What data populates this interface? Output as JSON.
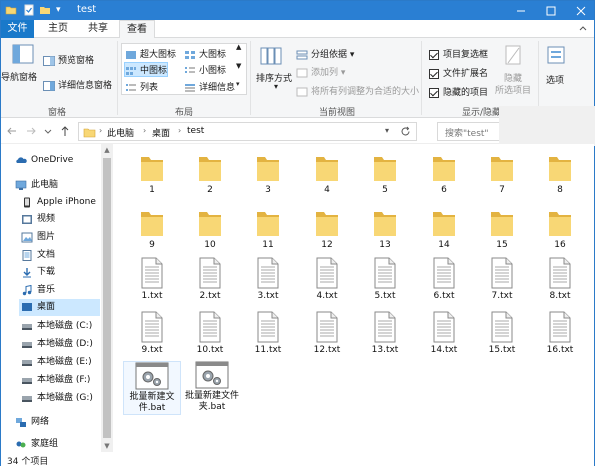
{
  "window": {
    "title": "test"
  },
  "ribbon": {
    "tabs": [
      {
        "label": "文件"
      },
      {
        "label": "主页"
      },
      {
        "label": "共享"
      },
      {
        "label": "查看"
      }
    ],
    "pane_group": {
      "nav_pane": "导航窗格",
      "preview": "预览窗格",
      "details": "详细信息窗格",
      "group_label": "窗格"
    },
    "layout_group": {
      "items": [
        "超大图标",
        "大图标",
        "中图标",
        "小图标",
        "列表",
        "详细信息"
      ],
      "group_label": "布局"
    },
    "view_group": {
      "sort_by": "排序方式",
      "group_by": "分组依据",
      "add_column": "添加列",
      "fit_columns": "将所有列调整为合适的大小",
      "group_label": "当前视图"
    },
    "show_group": {
      "checkboxes": [
        "项目复选框",
        "文件扩展名",
        "隐藏的项目"
      ],
      "hide": "隐藏",
      "hide_selected": "所选项目",
      "options": "选项",
      "group_label": "显示/隐藏"
    }
  },
  "address": {
    "crumbs": [
      "此电脑",
      "桌面",
      "test"
    ],
    "search_placeholder": "搜索\"test\""
  },
  "nav_pane": {
    "items": [
      {
        "label": "OneDrive",
        "icon": "onedrive-icon"
      },
      {
        "label": "此电脑",
        "icon": "computer-icon"
      },
      {
        "label": "Apple iPhone",
        "icon": "phone-icon"
      },
      {
        "label": "视频",
        "icon": "video-icon"
      },
      {
        "label": "图片",
        "icon": "pictures-icon"
      },
      {
        "label": "文档",
        "icon": "documents-icon"
      },
      {
        "label": "下载",
        "icon": "download-icon"
      },
      {
        "label": "音乐",
        "icon": "music-icon"
      },
      {
        "label": "桌面",
        "icon": "desktop-icon"
      },
      {
        "label": "本地磁盘 (C:)",
        "icon": "drive-icon"
      },
      {
        "label": "本地磁盘 (D:)",
        "icon": "drive-icon"
      },
      {
        "label": "本地磁盘 (E:)",
        "icon": "drive-icon"
      },
      {
        "label": "本地磁盘 (F:)",
        "icon": "drive-icon"
      },
      {
        "label": "本地磁盘 (G:)",
        "icon": "drive-icon"
      },
      {
        "label": "网络",
        "icon": "network-icon"
      },
      {
        "label": "家庭组",
        "icon": "homegroup-icon"
      }
    ]
  },
  "files": {
    "folders": [
      "1",
      "2",
      "3",
      "4",
      "5",
      "6",
      "7",
      "8",
      "9",
      "10",
      "11",
      "12",
      "13",
      "14",
      "15",
      "16"
    ],
    "texts": [
      "1.txt",
      "2.txt",
      "3.txt",
      "4.txt",
      "5.txt",
      "6.txt",
      "7.txt",
      "8.txt",
      "9.txt",
      "10.txt",
      "11.txt",
      "12.txt",
      "13.txt",
      "14.txt",
      "15.txt",
      "16.txt"
    ],
    "batch": [
      "批量新建文件.bat",
      "批量新建文件夹.bat"
    ]
  },
  "status": {
    "count": "34 个项目"
  },
  "colors": {
    "accent": "#2a7fd3",
    "folder": "#f8d775",
    "folder_dark": "#e3b341",
    "selection": "#cce8ff"
  }
}
